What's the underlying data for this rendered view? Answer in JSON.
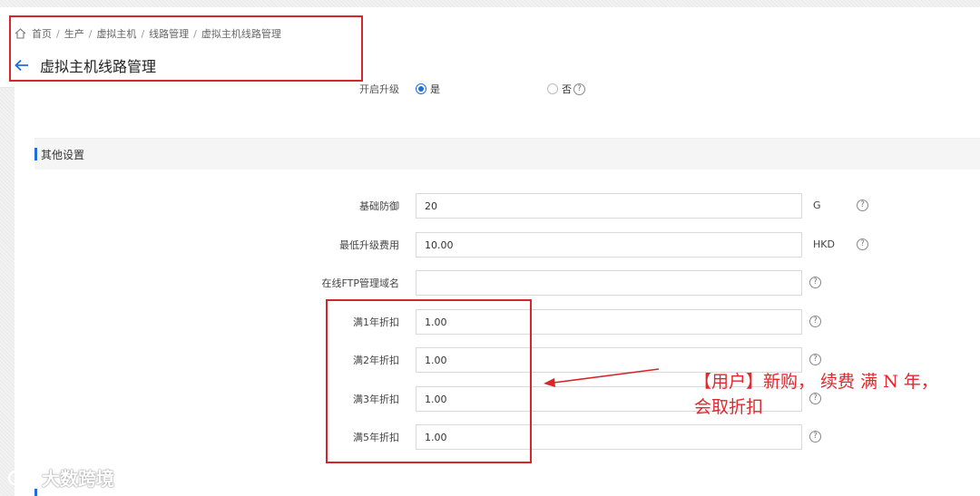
{
  "breadcrumb": {
    "items": [
      "首页",
      "生产",
      "虚拟主机",
      "线路管理",
      "虚拟主机线路管理"
    ]
  },
  "page": {
    "title": "虚拟主机线路管理"
  },
  "upgrade_radio": {
    "label": "开启升级",
    "options": [
      {
        "label": "是",
        "selected": true
      },
      {
        "label": "否",
        "selected": false
      }
    ]
  },
  "section": {
    "title": "其他设置"
  },
  "fields": {
    "basic_defense": {
      "label": "基础防御",
      "value": "20",
      "unit": "G"
    },
    "min_upgrade_fee": {
      "label": "最低升级费用",
      "value": "10.00",
      "unit": "HKD"
    },
    "ftp_domain": {
      "label": "在线FTP管理域名",
      "value": ""
    },
    "discount_1y": {
      "label": "满1年折扣",
      "value": "1.00"
    },
    "discount_2y": {
      "label": "满2年折扣",
      "value": "1.00"
    },
    "discount_3y": {
      "label": "满3年折扣",
      "value": "1.00"
    },
    "discount_5y": {
      "label": "满5年折扣",
      "value": "1.00"
    }
  },
  "annotation": {
    "line1": "【用户】新购， 续费 满 N 年，",
    "line2": "会取折扣",
    "color": "#e0282e"
  },
  "watermark": {
    "text": "大数跨境"
  },
  "colors": {
    "accent": "#1e6fd9",
    "annotation_red": "#d6262c"
  }
}
